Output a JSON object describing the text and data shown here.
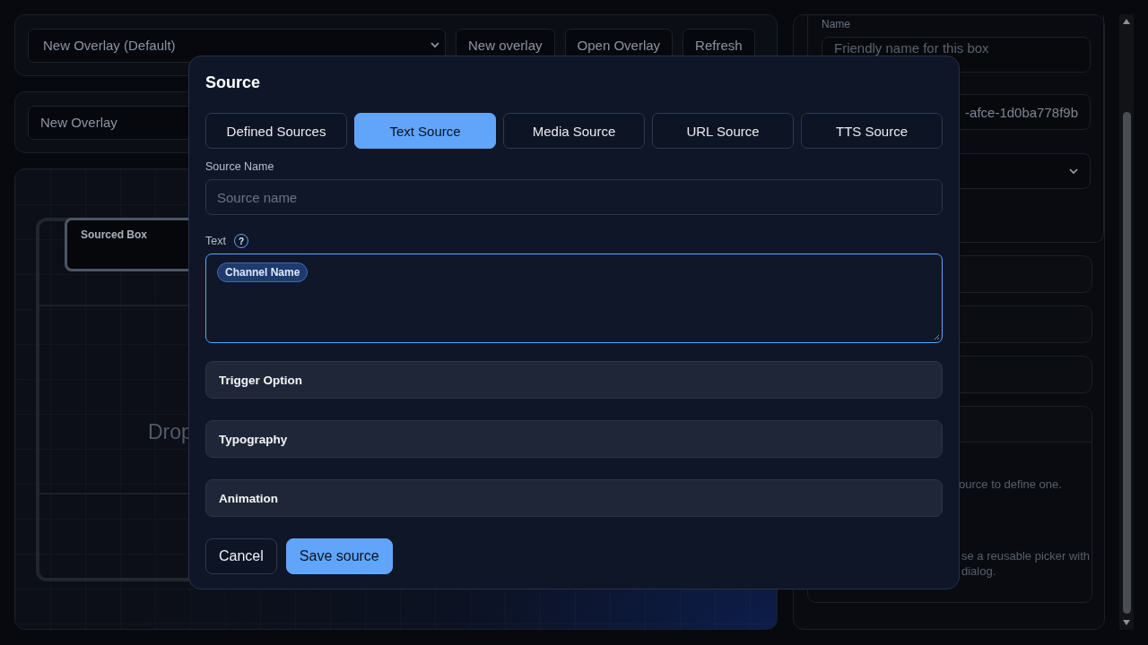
{
  "background": {
    "overlay_select": {
      "value": "New Overlay (Default)"
    },
    "toolbar_buttons": [
      "New overlay",
      "Open Overlay",
      "Refresh"
    ],
    "overlay_name": {
      "value": "New Overlay"
    },
    "canvas": {
      "box_label": "Sourced Box",
      "drop_hint": "Drop"
    },
    "inspector": {
      "name_label": "Name",
      "name_placeholder": "Friendly name for this box",
      "id_value": "-afce-1d0ba778f9b",
      "source_note": "ource to define one.",
      "picker_note_lines": [
        "se a reusable picker with",
        "dialog."
      ]
    }
  },
  "dialog": {
    "title": "Source",
    "tabs": [
      {
        "label": "Defined Sources",
        "selected": false
      },
      {
        "label": "Text Source",
        "selected": true
      },
      {
        "label": "Media Source",
        "selected": false
      },
      {
        "label": "URL Source",
        "selected": false
      },
      {
        "label": "TTS Source",
        "selected": false
      }
    ],
    "source_name": {
      "label": "Source Name",
      "placeholder": "Source name"
    },
    "text": {
      "label": "Text",
      "help_icon": "?",
      "tokens": [
        "Channel Name"
      ]
    },
    "sections": [
      "Trigger Option",
      "Typography",
      "Animation"
    ],
    "buttons": [
      {
        "label": "Cancel",
        "kind": "secondary"
      },
      {
        "label": "Save source",
        "kind": "primary"
      }
    ]
  }
}
